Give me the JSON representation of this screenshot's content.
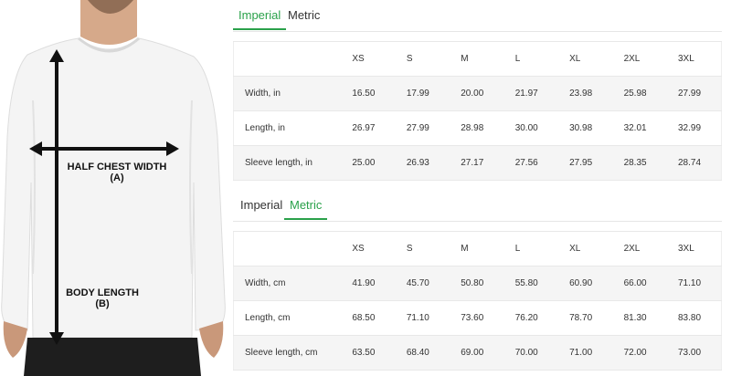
{
  "illustration": {
    "label_a_line1": "HALF CHEST WIDTH",
    "label_a_line2": "(A)",
    "label_b_line1": "BODY LENGTH",
    "label_b_line2": "(B)"
  },
  "imperial_block": {
    "tabs": [
      {
        "label": "Imperial",
        "active": true
      },
      {
        "label": "Metric",
        "active": false
      }
    ],
    "table": {
      "headers": [
        "",
        "XS",
        "S",
        "M",
        "L",
        "XL",
        "2XL",
        "3XL"
      ],
      "rows": [
        {
          "label": "Width, in",
          "values": [
            "16.50",
            "17.99",
            "20.00",
            "21.97",
            "23.98",
            "25.98",
            "27.99"
          ]
        },
        {
          "label": "Length, in",
          "values": [
            "26.97",
            "27.99",
            "28.98",
            "30.00",
            "30.98",
            "32.01",
            "32.99"
          ]
        },
        {
          "label": "Sleeve length, in",
          "values": [
            "25.00",
            "26.93",
            "27.17",
            "27.56",
            "27.95",
            "28.35",
            "28.74"
          ]
        }
      ]
    }
  },
  "metric_block": {
    "tabs": [
      {
        "label": "Imperial",
        "active": false
      },
      {
        "label": "Metric",
        "active": true
      }
    ],
    "table": {
      "headers": [
        "",
        "XS",
        "S",
        "M",
        "L",
        "XL",
        "2XL",
        "3XL"
      ],
      "rows": [
        {
          "label": "Width, cm",
          "values": [
            "41.90",
            "45.70",
            "50.80",
            "55.80",
            "60.90",
            "66.00",
            "71.10"
          ]
        },
        {
          "label": "Length, cm",
          "values": [
            "68.50",
            "71.10",
            "73.60",
            "76.20",
            "78.70",
            "81.30",
            "83.80"
          ]
        },
        {
          "label": "Sleeve length, cm",
          "values": [
            "63.50",
            "68.40",
            "69.00",
            "70.00",
            "71.00",
            "72.00",
            "73.00"
          ]
        }
      ]
    }
  },
  "colors": {
    "accent": "#2aa14a",
    "text": "#333333",
    "row_stripe": "#f5f5f5"
  }
}
